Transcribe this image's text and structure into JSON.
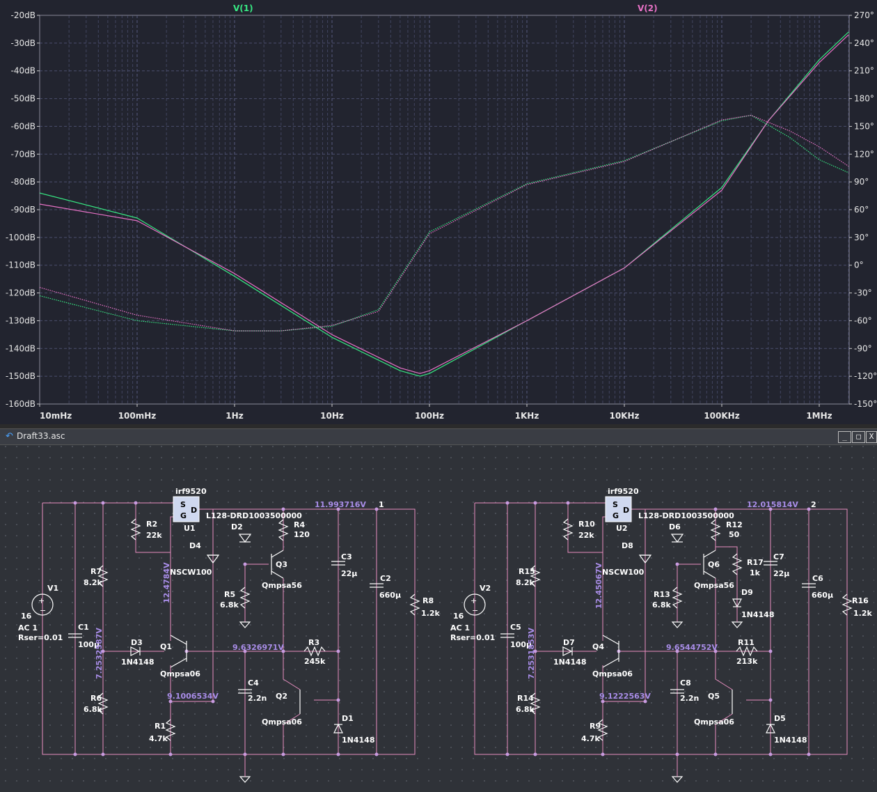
{
  "plot": {
    "trace_labels": [
      "V(1)",
      "V(2)"
    ],
    "colors": {
      "v1": "#37e883",
      "v2": "#e872c6",
      "background": "#22242f",
      "grid": "#5c6088"
    },
    "left_axis_ticks": [
      "-20dB",
      "-30dB",
      "-40dB",
      "-50dB",
      "-60dB",
      "-70dB",
      "-80dB",
      "-90dB",
      "-100dB",
      "-110dB",
      "-120dB",
      "-130dB",
      "-140dB",
      "-150dB",
      "-160dB"
    ],
    "right_axis_ticks": [
      "270°",
      "240°",
      "210°",
      "180°",
      "150°",
      "120°",
      "90°",
      "60°",
      "30°",
      "0°",
      "-30°",
      "-60°",
      "-90°",
      "-120°",
      "-150°"
    ],
    "x_axis_ticks": [
      "10mHz",
      "100mHz",
      "1Hz",
      "10Hz",
      "100Hz",
      "1KHz",
      "10KHz",
      "100KHz",
      "1MHz"
    ]
  },
  "chart_data": {
    "type": "line",
    "xscale": "log",
    "xlim_hz": [
      0.01,
      2000000
    ],
    "ylim_db": [
      -160,
      -20
    ],
    "y2lim_deg": [
      -150,
      270
    ],
    "grid": true,
    "series": [
      {
        "name": "V(1)",
        "quantity": "magnitude_db",
        "x": [
          0.01,
          0.1,
          1,
          10,
          50,
          80,
          100,
          1000,
          10000,
          100000,
          300000,
          1000000,
          2000000
        ],
        "y": [
          -84,
          -93,
          -114,
          -136,
          -148,
          -150,
          -149,
          -130,
          -111,
          -82,
          -58,
          -36,
          -26
        ]
      },
      {
        "name": "V(2)",
        "quantity": "magnitude_db",
        "x": [
          0.01,
          0.1,
          1,
          10,
          50,
          80,
          100,
          1000,
          10000,
          100000,
          300000,
          1000000,
          2000000
        ],
        "y": [
          -88,
          -94,
          -113,
          -135,
          -147,
          -149,
          -148,
          -130,
          -111,
          -83,
          -58,
          -37,
          -27
        ]
      },
      {
        "name": "V(1)",
        "quantity": "phase_deg",
        "x": [
          0.01,
          0.1,
          1,
          3,
          10,
          30,
          100,
          1000,
          10000,
          100000,
          200000,
          500000,
          1000000,
          2000000
        ],
        "y": [
          -33,
          -60,
          -71,
          -71,
          -66,
          -48,
          36,
          88,
          113,
          156,
          162,
          138,
          114,
          100
        ]
      },
      {
        "name": "V(2)",
        "quantity": "phase_deg",
        "x": [
          0.01,
          0.1,
          1,
          3,
          10,
          30,
          100,
          1000,
          10000,
          100000,
          200000,
          500000,
          1000000,
          2000000
        ],
        "y": [
          -24,
          -54,
          -71,
          -71,
          -65,
          -50,
          34,
          87,
          112,
          157,
          162,
          145,
          128,
          107
        ]
      }
    ]
  },
  "schematic": {
    "window_title": "Draft33.asc",
    "buttons": {
      "minimize": "_",
      "maximize": "□",
      "close": "X"
    },
    "left": {
      "source": {
        "name": "V1",
        "value": "16",
        "ac": "AC 1",
        "rser": "Rser=0.01"
      },
      "mosfet": {
        "model": "irf9520",
        "ref": "U1",
        "s": "S",
        "g": "G",
        "d": "D"
      },
      "inductor": "L128-DRD1003500000",
      "node_label": "1",
      "parts": {
        "R2": "R2",
        "R2v": "22k",
        "R7": "R7",
        "R7v": "8.2k",
        "R6": "R6",
        "R6v": "6.8k",
        "R1": "R1",
        "R1v": "4.7k",
        "R4": "R4",
        "R4v": "120",
        "R5": "R5",
        "R5v": "6.8k",
        "R3": "R3",
        "R3v": "245k",
        "R8": "R8",
        "R8v": "1.2k",
        "C1": "C1",
        "C1v": "100µ",
        "C2": "C2",
        "C2v": "660µ",
        "C3": "C3",
        "C3v": "22µ",
        "C4": "C4",
        "C4v": "2.2n",
        "D1": "D1",
        "D1v": "1N4148",
        "D2": "D2",
        "D3": "D3",
        "D3v": "1N4148",
        "D4": "D4",
        "D4v": "NSCW100",
        "Q1": "Q1",
        "Q1v": "Qmpsa06",
        "Q2": "Q2",
        "Q2v": "Qmpsa06",
        "Q3": "Q3",
        "Q3v": "Qmpsa56"
      },
      "voltages": {
        "out": "11.993716V",
        "gate": "12.4784V",
        "base": "7.2532587V",
        "mid": "9.6326971V",
        "emit": "9.1006534V"
      }
    },
    "right": {
      "source": {
        "name": "V2",
        "value": "16",
        "ac": "AC 1",
        "rser": "Rser=0.01"
      },
      "mosfet": {
        "model": "irf9520",
        "ref": "U2",
        "s": "S",
        "g": "G",
        "d": "D"
      },
      "inductor": "L128-DRD1003500000",
      "node_label": "2",
      "parts": {
        "R10": "R10",
        "R10v": "22k",
        "R15": "R15",
        "R15v": "8.2k",
        "R14": "R14",
        "R14v": "6.8k",
        "R9": "R9",
        "R9v": "4.7k",
        "R12": "R12",
        "R12v": "50",
        "R17": "R17",
        "R17v": "1k",
        "R13": "R13",
        "R13v": "6.8k",
        "R11": "R11",
        "R11v": "213k",
        "R16": "R16",
        "R16v": "1.2k",
        "C5": "C5",
        "C5v": "100µ",
        "C6": "C6",
        "C6v": "660µ",
        "C7": "C7",
        "C7v": "22µ",
        "C8": "C8",
        "C8v": "2.2n",
        "D5": "D5",
        "D5v": "1N4148",
        "D6": "D6",
        "D7": "D7",
        "D7v": "1N4148",
        "D8": "D8",
        "D8v": "NSCW100",
        "D9": "D9",
        "D9v": "1N4148",
        "Q4": "Q4",
        "Q4v": "Qmpsa06",
        "Q5": "Q5",
        "Q5v": "Qmpsa06",
        "Q6": "Q6",
        "Q6v": "Qmpsa56"
      },
      "voltages": {
        "out": "12.015814V",
        "gate": "12.45067V",
        "base": "7.2531853V",
        "mid": "9.6544752V",
        "emit": "9.1222563V"
      }
    }
  }
}
